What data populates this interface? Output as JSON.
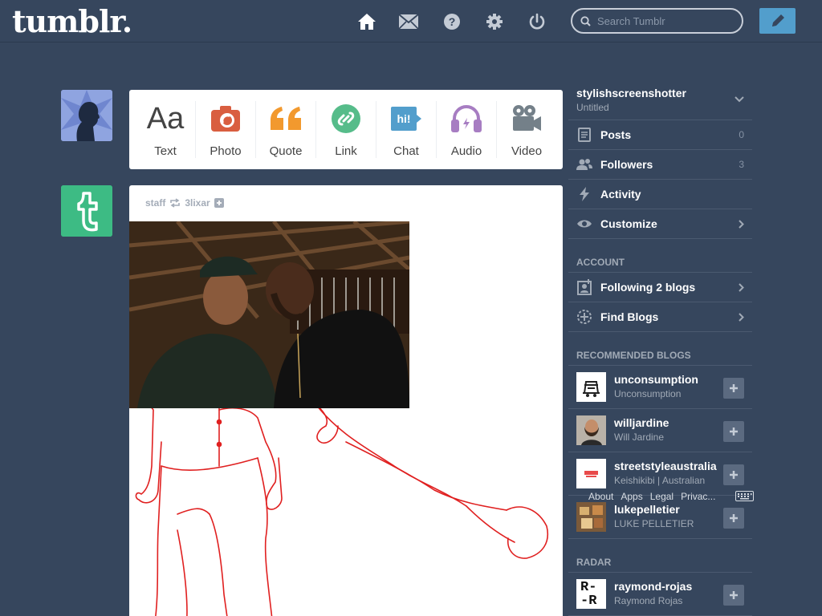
{
  "header": {
    "logo": "tumblr.",
    "search_placeholder": "Search Tumblr",
    "nav_icons": [
      "home-icon",
      "inbox-icon",
      "help-icon",
      "settings-icon",
      "logout-icon"
    ]
  },
  "post_types": [
    {
      "label": "Text",
      "icon": "text-icon",
      "color": "#444444"
    },
    {
      "label": "Photo",
      "icon": "camera-icon",
      "color": "#d95e40"
    },
    {
      "label": "Quote",
      "icon": "quote-icon",
      "color": "#f2992e"
    },
    {
      "label": "Link",
      "icon": "link-icon",
      "color": "#56bc8a"
    },
    {
      "label": "Chat",
      "icon": "chat-icon",
      "color": "#529ecc",
      "glyph": "hi!"
    },
    {
      "label": "Audio",
      "icon": "headphones-icon",
      "color": "#a77dc2"
    },
    {
      "label": "Video",
      "icon": "video-icon",
      "color": "#748089"
    }
  ],
  "post": {
    "author": "staff",
    "reblogged_from": "3lixar"
  },
  "sidebar": {
    "blog_name": "stylishscreenshotter",
    "blog_title": "Untitled",
    "items": [
      {
        "label": "Posts",
        "count": "0",
        "icon": "posts-icon"
      },
      {
        "label": "Followers",
        "count": "3",
        "icon": "followers-icon"
      },
      {
        "label": "Activity",
        "count": "",
        "icon": "activity-icon"
      },
      {
        "label": "Customize",
        "count": "",
        "icon": "eye-icon"
      }
    ],
    "account_heading": "ACCOUNT",
    "account_items": [
      {
        "label": "Following 2 blogs",
        "icon": "following-icon"
      },
      {
        "label": "Find Blogs",
        "icon": "find-blogs-icon"
      }
    ],
    "recommended_heading": "RECOMMENDED BLOGS",
    "recommended": [
      {
        "name": "unconsumption",
        "title": "Unconsumption"
      },
      {
        "name": "willjardine",
        "title": "Will Jardine"
      },
      {
        "name": "streetstyleaustralia",
        "title": "Keishikibi | Australian"
      },
      {
        "name": "lukepelletier",
        "title": "LUKE PELLETIER"
      }
    ],
    "radar_heading": "RADAR",
    "radar": [
      {
        "name": "raymond-rojas",
        "title": "Raymond Rojas",
        "avatar_text": "R-\n-R"
      }
    ],
    "footer_links": [
      "About",
      "Apps",
      "Legal",
      "Privac..."
    ]
  },
  "colors": {
    "background": "#36465d",
    "accent": "#529ecc",
    "tumblr_green": "#3dbb84"
  }
}
